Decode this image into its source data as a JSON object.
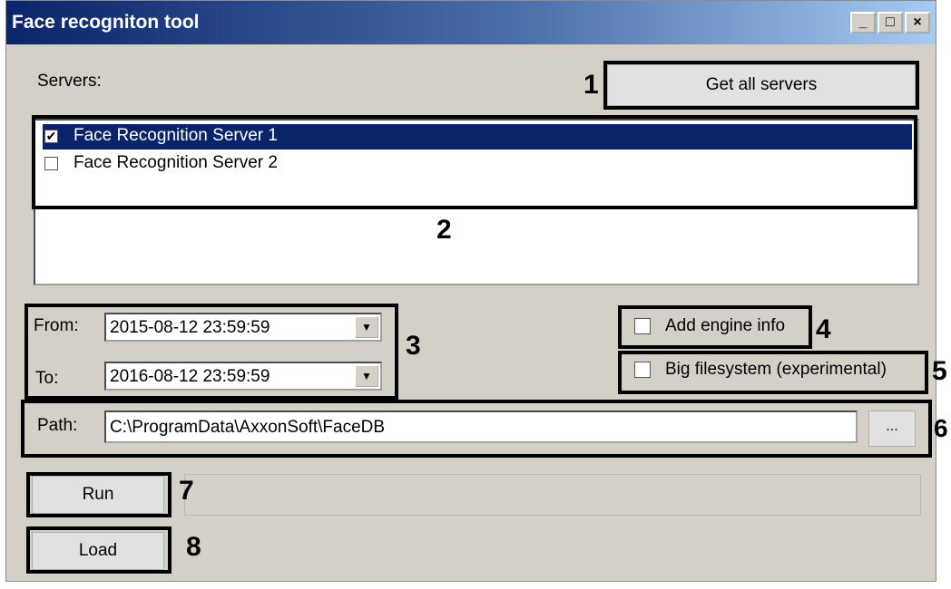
{
  "window": {
    "title": "Face recogniton tool",
    "minimize": "_",
    "maximize": "□",
    "close": "×"
  },
  "servers": {
    "label": "Servers:",
    "get_all_button": "Get all servers",
    "items": [
      {
        "label": "Face Recognition Server 1",
        "checked": true,
        "check_glyph": "✔",
        "selected": true
      },
      {
        "label": "Face Recognition Server 2",
        "checked": false,
        "check_glyph": "",
        "selected": false
      }
    ]
  },
  "range": {
    "from_label": "From:",
    "from_value": "2015-08-12 23:59:59",
    "to_label": "To:",
    "to_value": "2016-08-12 23:59:59",
    "dropdown_glyph": "▼"
  },
  "options": {
    "add_engine_info": {
      "label": "Add engine info",
      "checked": false
    },
    "big_filesystem": {
      "label": "Big filesystem (experimental)",
      "checked": false
    }
  },
  "path": {
    "label": "Path:",
    "value": "C:\\ProgramData\\AxxonSoft\\FaceDB",
    "browse_button": "..."
  },
  "actions": {
    "run_button": "Run",
    "load_button": "Load"
  },
  "progress": {
    "fraction": 0.0
  },
  "callouts": [
    "1",
    "2",
    "3",
    "4",
    "5",
    "6",
    "7",
    "8"
  ]
}
